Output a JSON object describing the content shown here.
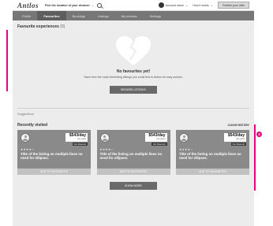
{
  "topbar": {
    "logo": "Antlos",
    "search_text": "Pick the location of your dreams!",
    "account_label": "Account name",
    "how_it_works": "How it works",
    "publish_label": "Publish your offer"
  },
  "tabs": [
    {
      "label": "Profile",
      "active": false
    },
    {
      "label": "Favourites",
      "active": true
    },
    {
      "label": "Bookings",
      "active": false
    },
    {
      "label": "Listings",
      "active": false
    },
    {
      "label": "My reviews",
      "active": false
    },
    {
      "label": "Settings",
      "active": false
    }
  ],
  "favourites": {
    "title": "Favourite experiences",
    "count": "(0)",
    "empty_title": "No favourites yet!",
    "empty_description": "Save here the most interesting listings you could find in Antlos for easy access.",
    "browse_button": "BROWSE LISTINGS"
  },
  "suggestions": {
    "label": "Suggestions",
    "recently_visited_title": "Recently visited",
    "clear_history": "CLEAR HISTORY",
    "show_more": "SHOW MORE",
    "cards": [
      {
        "price": "$543/day",
        "per": "per guest",
        "badge": "Inst. Reserved",
        "rating": "★★★★☆",
        "title": "Title of the listing on multiple lines no need for ellipses.",
        "action": "ADD TO FAVOURITES"
      },
      {
        "price": "$543/day",
        "per": "per guest",
        "badge": "Inst. Reserved",
        "rating": "★★★★☆",
        "title": "Title of the listing on multiple lines no need for ellipses.",
        "action": "ADD TO FAVOURITES"
      },
      {
        "price": "$543/day",
        "per": "per guest",
        "badge": "Inst. Reserved",
        "rating": "★★★★☆",
        "title": "Title of the listing on multiple lines no need for ellipses.",
        "action": "ADD TO FAVOURITES"
      }
    ]
  },
  "annotations": {
    "marker_3": "3"
  },
  "colors": {
    "annotation": "#e6007e",
    "navbar": "#777777",
    "card": "#8a8a8a"
  }
}
